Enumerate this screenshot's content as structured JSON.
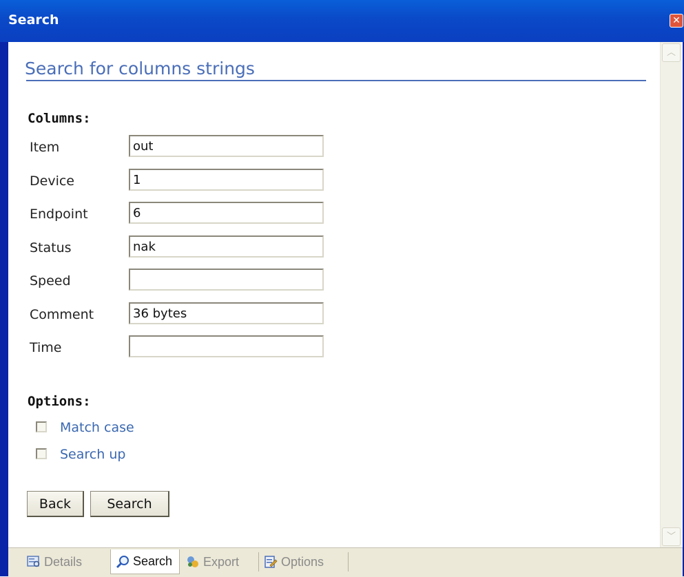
{
  "window": {
    "title": "Search"
  },
  "page": {
    "heading": "Search for columns strings",
    "columns_label": "Columns:",
    "fields": [
      {
        "label": "Item",
        "value": "out"
      },
      {
        "label": "Device",
        "value": "1"
      },
      {
        "label": "Endpoint",
        "value": "6"
      },
      {
        "label": "Status",
        "value": "nak"
      },
      {
        "label": "Speed",
        "value": ""
      },
      {
        "label": "Comment",
        "value": "36 bytes"
      },
      {
        "label": "Time",
        "value": ""
      }
    ],
    "options_label": "Options:",
    "options": [
      {
        "label": "Match case",
        "checked": false
      },
      {
        "label": "Search up",
        "checked": false
      }
    ],
    "buttons": {
      "back": "Back",
      "search": "Search"
    }
  },
  "tabs": [
    {
      "label": "Details",
      "icon": "details-icon",
      "active": false
    },
    {
      "label": "Search",
      "icon": "search-icon",
      "active": true
    },
    {
      "label": "Export",
      "icon": "export-icon",
      "active": false
    },
    {
      "label": "Options",
      "icon": "options-icon",
      "active": false
    }
  ],
  "colors": {
    "titlebar": "#0a49c8",
    "heading": "#4a6eb8",
    "link": "#3a68b0",
    "tabbar": "#ece9d8"
  }
}
